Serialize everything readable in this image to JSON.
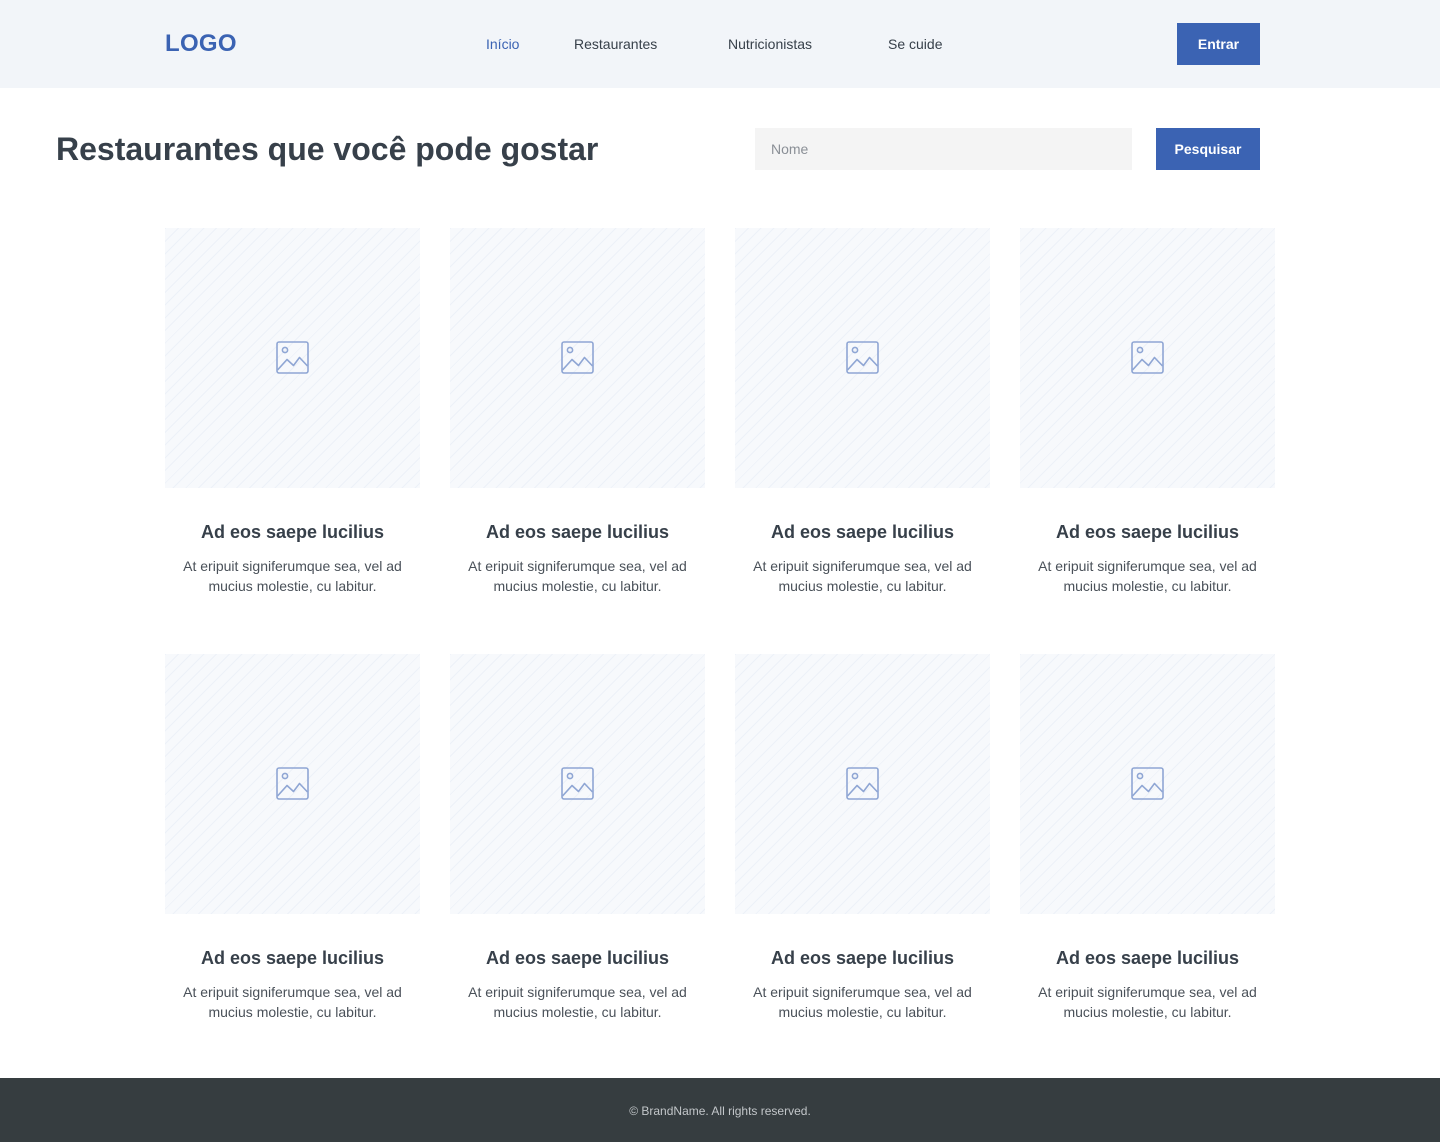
{
  "header": {
    "logo": "LOGO",
    "nav": [
      {
        "label": "Início",
        "active": true
      },
      {
        "label": "Restaurantes",
        "active": false
      },
      {
        "label": "Nutricionistas",
        "active": false
      },
      {
        "label": "Se cuide",
        "active": false
      }
    ],
    "login_label": "Entrar"
  },
  "main": {
    "title": "Restaurantes que você pode gostar",
    "search": {
      "placeholder": "Nome",
      "value": ""
    },
    "search_button_label": "Pesquisar"
  },
  "cards": [
    {
      "title": "Ad eos saepe lucilius",
      "description": "At eripuit signiferumque sea, vel ad mucius molestie, cu labitur.",
      "image_icon": "image-icon"
    },
    {
      "title": "Ad eos saepe lucilius",
      "description": "At eripuit signiferumque sea, vel ad mucius molestie, cu labitur.",
      "image_icon": "image-icon"
    },
    {
      "title": "Ad eos saepe lucilius",
      "description": "At eripuit signiferumque sea, vel ad mucius molestie, cu labitur.",
      "image_icon": "image-icon"
    },
    {
      "title": "Ad eos saepe lucilius",
      "description": "At eripuit signiferumque sea, vel ad mucius molestie, cu labitur.",
      "image_icon": "image-icon"
    },
    {
      "title": "Ad eos saepe lucilius",
      "description": "At eripuit signiferumque sea, vel ad mucius molestie, cu labitur.",
      "image_icon": "image-icon"
    },
    {
      "title": "Ad eos saepe lucilius",
      "description": "At eripuit signiferumque sea, vel ad mucius molestie, cu labitur.",
      "image_icon": "image-icon"
    },
    {
      "title": "Ad eos saepe lucilius",
      "description": "At eripuit signiferumque sea, vel ad mucius molestie, cu labitur.",
      "image_icon": "image-icon"
    },
    {
      "title": "Ad eos saepe lucilius",
      "description": "At eripuit signiferumque sea, vel ad mucius molestie, cu labitur.",
      "image_icon": "image-icon"
    }
  ],
  "footer": {
    "text": "© BrandName. All rights reserved."
  },
  "colors": {
    "accent": "#3b63b3",
    "header_bg": "#f2f5f9",
    "footer_bg": "#363d40",
    "text": "#37404a",
    "input_bg": "#f4f4f4"
  }
}
